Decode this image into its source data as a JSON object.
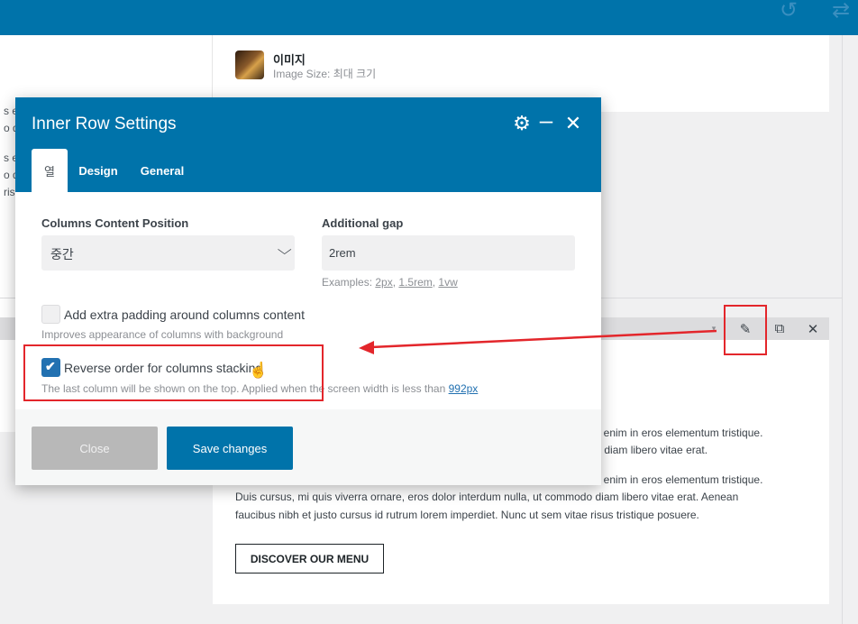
{
  "icons": {
    "undo": "undo-icon",
    "redo": "redo-icon",
    "gear": "gear-icon",
    "minimize": "minimize-icon",
    "close": "close-icon",
    "pencil": "pencil-icon",
    "duplicate": "duplicate-icon"
  },
  "left_panel": {
    "lines": [
      "s en",
      "o di",
      "s en",
      "o di",
      "ris"
    ]
  },
  "image_card": {
    "title": "이미지",
    "subtitle": "Image Size: 최대 크기"
  },
  "row_toolbar": {
    "caret": "▾",
    "pencil": "✎",
    "duplicate": "⧉",
    "remove": "✕"
  },
  "content": {
    "line1": "rius enim in eros elementum tristique.",
    "line2": "odo diam libero vitae erat.",
    "line3": "rius enim in eros elementum tristique.",
    "line4": "Duis cursus, mi quis viverra ornare, eros dolor interdum nulla, ut commodo diam libero vitae erat. Aenean",
    "line5": "faucibus nibh et justo cursus id rutrum lorem imperdiet. Nunc ut sem vitae risus tristique posuere.",
    "button": "DISCOVER OUR MENU"
  },
  "modal": {
    "title": "Inner Row Settings",
    "tabs": [
      "열",
      "Design",
      "General"
    ],
    "fields": {
      "position_label": "Columns Content Position",
      "position_value": "중간",
      "gap_label": "Additional gap",
      "gap_value": "2rem",
      "examples_prefix": "Examples: ",
      "examples": [
        "2px",
        "1.5rem",
        "1vw"
      ],
      "padding_label": "Add extra padding around columns content",
      "padding_help": "Improves appearance of columns with background",
      "padding_checked": false,
      "reverse_label": "Reverse order for columns stacking",
      "reverse_help": "The last column will be shown on the top. Applied when the screen width is less than ",
      "reverse_help_link": "992px",
      "reverse_checked": true
    },
    "buttons": {
      "close": "Close",
      "save": "Save changes"
    }
  },
  "colors": {
    "header_blue": "#0073aa",
    "checkbox_blue": "#2271b1",
    "annotation_red": "#e3262b",
    "disabled_gray": "#b8b8b8"
  }
}
